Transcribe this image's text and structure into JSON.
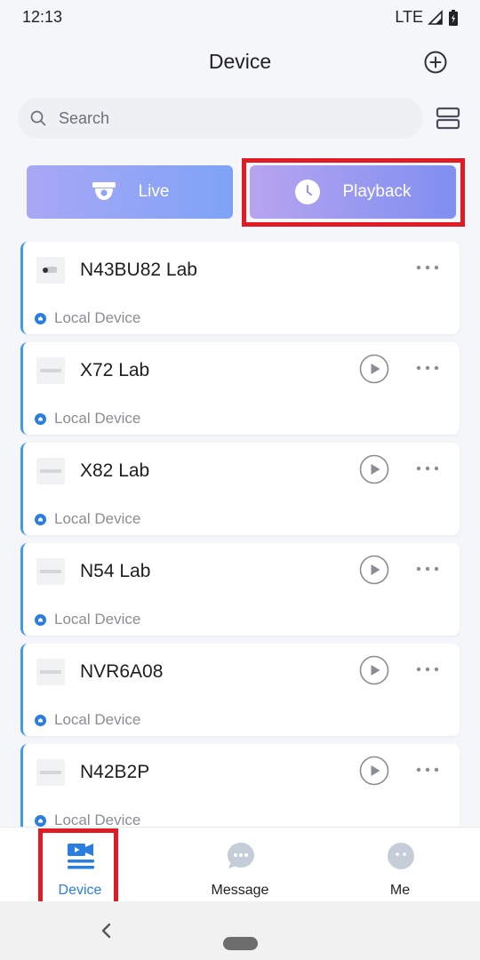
{
  "status_bar": {
    "time": "12:13",
    "network": "LTE"
  },
  "header": {
    "title": "Device"
  },
  "search": {
    "placeholder": "Search",
    "value": ""
  },
  "modes": {
    "live_label": "Live",
    "playback_label": "Playback"
  },
  "devices": [
    {
      "name": "N43BU82 Lab",
      "subtitle": "Local Device",
      "thumb": "bullet-camera",
      "has_playback": false
    },
    {
      "name": "X72 Lab",
      "subtitle": "Local Device",
      "thumb": "nvr",
      "has_playback": true
    },
    {
      "name": "X82 Lab",
      "subtitle": "Local Device",
      "thumb": "nvr",
      "has_playback": true
    },
    {
      "name": "N54 Lab",
      "subtitle": "Local Device",
      "thumb": "nvr",
      "has_playback": true
    },
    {
      "name": "NVR6A08",
      "subtitle": "Local Device",
      "thumb": "nvr",
      "has_playback": true
    },
    {
      "name": "N42B2P",
      "subtitle": "Local Device",
      "thumb": "nvr",
      "has_playback": true
    }
  ],
  "bottom_nav": {
    "items": [
      {
        "label": "Device",
        "icon": "camera-video-icon",
        "active": true
      },
      {
        "label": "Message",
        "icon": "chat-bubble-icon",
        "active": false
      },
      {
        "label": "Me",
        "icon": "profile-icon",
        "active": false
      }
    ]
  },
  "colors": {
    "accent": "#2a7de1",
    "card_border": "#3f9bea",
    "highlight": "#e01b24",
    "nav_inactive_icon": "#c5cdd9"
  }
}
